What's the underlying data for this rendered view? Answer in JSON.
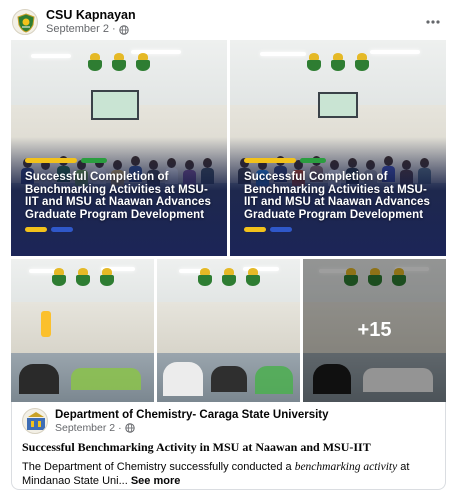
{
  "post": {
    "page_name": "CSU Kapnayan",
    "date": "September 2",
    "separator": "·",
    "more_icon": "more-horizontal-icon",
    "audience_icon": "globe-icon"
  },
  "photos": {
    "caption": "Successful Completion of Benchmarking Activities at MSU-IIT and MSU at Naawan Advances Graduate Program Development",
    "more_count": "+15",
    "colors": {
      "caption_overlay": "#1c2558",
      "accent_yellow": "#f2c21b",
      "accent_green": "#2a9d3f",
      "accent_blue": "#2f58c9"
    }
  },
  "shared": {
    "page_name": "Department of Chemistry- Caraga State University",
    "date": "September 2",
    "separator": "·",
    "title": "Successful Benchmarking Activity in MSU at Naawan and MSU-IIT",
    "body_start": "The Department of Chemistry successfully conducted a ",
    "body_em": "benchmarking activity",
    "body_end": "  at Mindanao State Uni... ",
    "see_more": "See more"
  }
}
